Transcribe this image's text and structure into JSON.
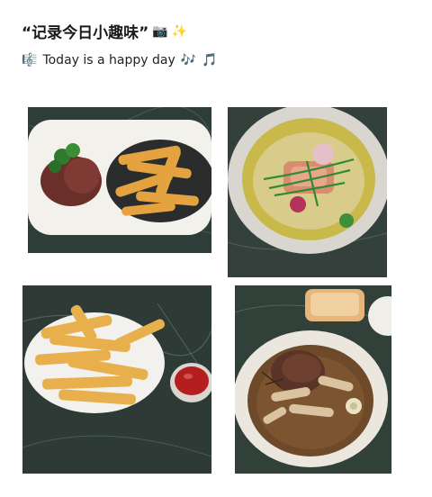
{
  "post": {
    "title": "“记录今日小趣味”",
    "title_emojis": [
      "📷",
      "✨"
    ],
    "subtitle_prefix_icon": "🎼",
    "subtitle": "Today is a happy day",
    "subtitle_suffix_icons": [
      "🎶",
      "🎵"
    ]
  },
  "photos": [
    {
      "name": "steak-and-fries-photo"
    },
    {
      "name": "fish-risotto-photo"
    },
    {
      "name": "fries-with-ketchup-photo"
    },
    {
      "name": "duck-soup-photo"
    }
  ]
}
